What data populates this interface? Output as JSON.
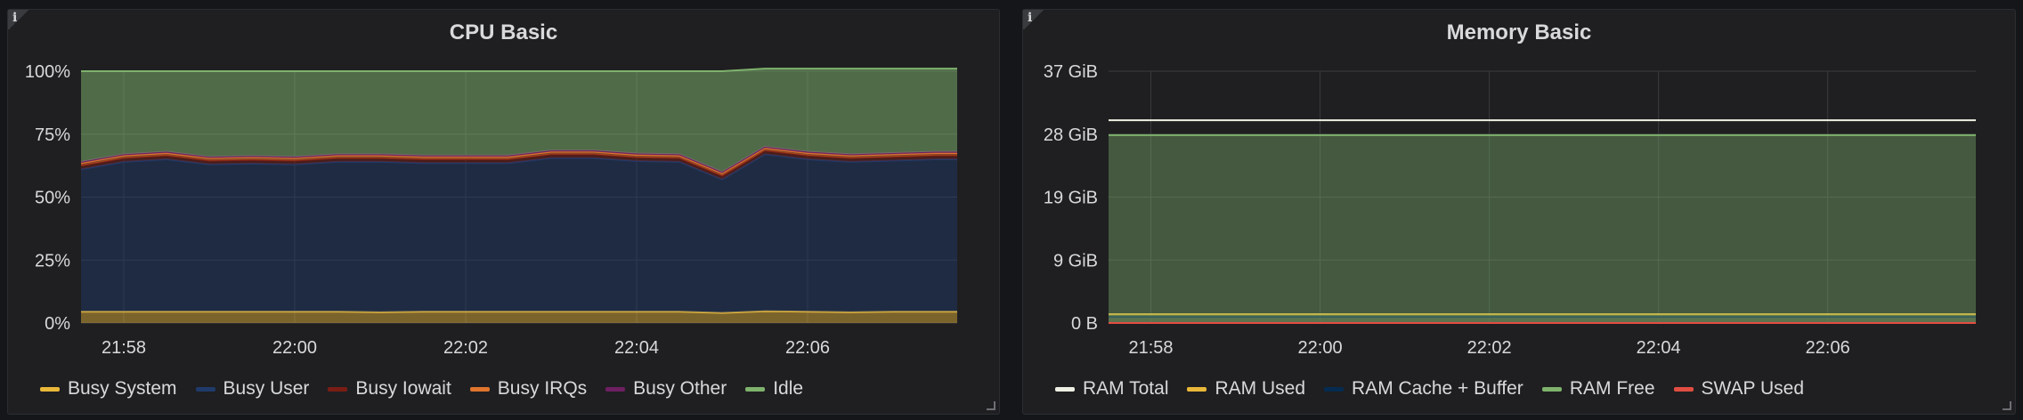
{
  "panels": [
    {
      "title": "CPU Basic",
      "info_glyph": "i",
      "chart_data": {
        "type": "area",
        "stacked": true,
        "x": [
          "21:57:30",
          "21:58",
          "21:58:30",
          "21:59",
          "21:59:30",
          "22:00",
          "22:00:30",
          "22:01",
          "22:01:30",
          "22:02",
          "22:02:30",
          "22:03",
          "22:03:30",
          "22:04",
          "22:04:30",
          "22:05",
          "22:05:30",
          "22:06",
          "22:06:30",
          "22:07",
          "22:07:30",
          "22:07:45"
        ],
        "x_ticks": [
          "21:58",
          "22:00",
          "22:02",
          "22:04",
          "22:06"
        ],
        "y_ticks": [
          "0%",
          "25%",
          "50%",
          "75%",
          "100%"
        ],
        "ylim": [
          0,
          100
        ],
        "grid": true,
        "legend_position": "bottom",
        "series": [
          {
            "name": "Busy System",
            "color": "#eab839",
            "values": [
              4.5,
              4.5,
              4.5,
              4.5,
              4.5,
              4.5,
              4.5,
              4.3,
              4.5,
              4.5,
              4.5,
              4.5,
              4.5,
              4.5,
              4.5,
              4.0,
              4.7,
              4.5,
              4.3,
              4.5,
              4.5,
              4.5
            ]
          },
          {
            "name": "Busy User",
            "color": "#1f3a6b",
            "values": [
              56.5,
              59.5,
              60.5,
              58.5,
              58.8,
              58.5,
              59.5,
              59.7,
              59.0,
              59.0,
              59.0,
              61.0,
              61.0,
              59.8,
              59.5,
              53.0,
              62.3,
              60.5,
              59.7,
              60.0,
              60.5,
              60.5
            ]
          },
          {
            "name": "Busy Iowait",
            "color": "#7a1d15",
            "values": [
              1.5,
              1.5,
              1.5,
              1.5,
              1.5,
              1.5,
              1.5,
              1.5,
              1.5,
              1.5,
              1.5,
              1.5,
              1.5,
              1.5,
              1.5,
              1.5,
              1.5,
              1.5,
              1.5,
              1.5,
              1.5,
              1.5
            ]
          },
          {
            "name": "Busy IRQs",
            "color": "#e0752d",
            "values": [
              1.0,
              1.0,
              1.0,
              1.0,
              1.0,
              1.0,
              1.0,
              1.0,
              1.0,
              1.0,
              1.0,
              1.0,
              1.0,
              1.0,
              1.0,
              1.0,
              1.0,
              1.0,
              1.0,
              1.0,
              1.0,
              1.0
            ]
          },
          {
            "name": "Busy Other",
            "color": "#6d1f62",
            "values": [
              0.5,
              0.5,
              0.5,
              0.5,
              0.5,
              0.5,
              0.5,
              0.5,
              0.5,
              0.5,
              0.5,
              0.5,
              0.5,
              0.5,
              0.5,
              0.5,
              0.5,
              0.5,
              0.5,
              0.5,
              0.5,
              0.5
            ]
          },
          {
            "name": "Idle",
            "color": "#7eb26d",
            "values": [
              36.0,
              33.0,
              32.0,
              34.0,
              33.7,
              34.0,
              33.0,
              33.0,
              33.5,
              33.5,
              33.5,
              31.5,
              31.5,
              32.7,
              33.0,
              40.0,
              31.0,
              33.0,
              34.0,
              33.5,
              33.0,
              33.0
            ]
          }
        ]
      }
    },
    {
      "title": "Memory Basic",
      "info_glyph": "i",
      "chart_data": {
        "type": "area",
        "stacked": false,
        "x": [
          "21:57:30",
          "22:07:45"
        ],
        "x_ticks": [
          "21:58",
          "22:00",
          "22:02",
          "22:04",
          "22:06"
        ],
        "y_ticks": [
          "0 B",
          "9 GiB",
          "19 GiB",
          "28 GiB",
          "37 GiB"
        ],
        "ylim": [
          0,
          37
        ],
        "grid": true,
        "legend_position": "bottom",
        "series": [
          {
            "name": "RAM Total",
            "color": "#eef0e4",
            "values": [
              29.8,
              29.8
            ]
          },
          {
            "name": "RAM Used",
            "color": "#eab839",
            "values": [
              1.3,
              1.3
            ]
          },
          {
            "name": "RAM Cache + Buffer",
            "color": "#052b51",
            "values": [
              0.9,
              0.9
            ]
          },
          {
            "name": "RAM Free",
            "color": "#7eb26d",
            "values": [
              27.6,
              27.6
            ]
          },
          {
            "name": "SWAP Used",
            "color": "#e24d42",
            "values": [
              0.0,
              0.0
            ]
          }
        ]
      }
    }
  ]
}
